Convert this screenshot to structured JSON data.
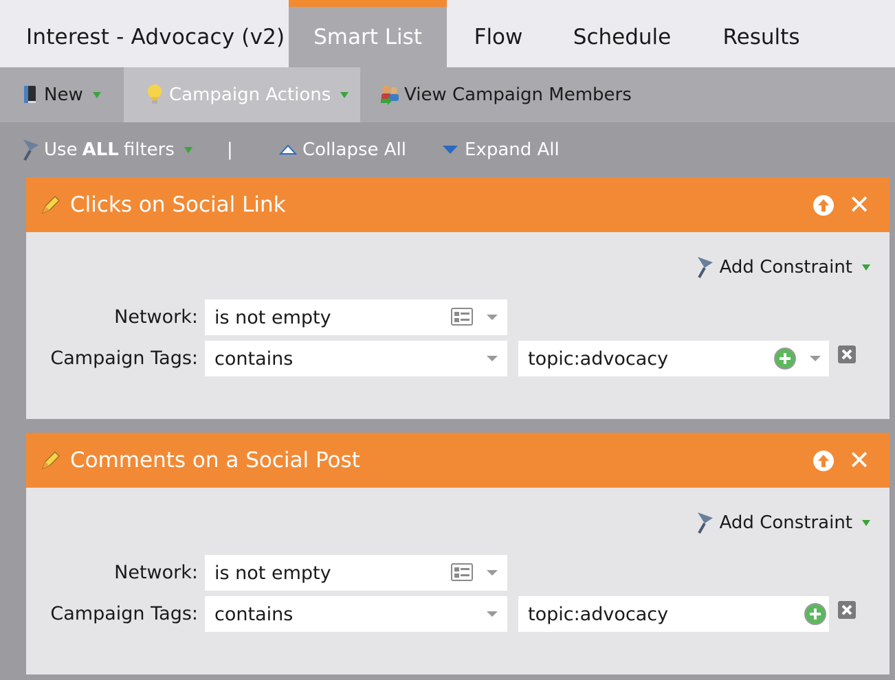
{
  "app": {
    "title": "Interest - Advocacy (v2)",
    "tabs": [
      {
        "label": "Smart List",
        "active": true
      },
      {
        "label": "Flow",
        "active": false
      },
      {
        "label": "Schedule",
        "active": false
      },
      {
        "label": "Results",
        "active": false
      }
    ]
  },
  "toolbar": {
    "new_label": "New",
    "campaign_actions_label": "Campaign Actions",
    "view_members_label": "View Campaign Members"
  },
  "filterbar": {
    "use_prefix": "Use",
    "use_bold": "ALL",
    "use_suffix": "filters",
    "separator": "|",
    "collapse_label": "Collapse All",
    "expand_label": "Expand All"
  },
  "filters": [
    {
      "title": "Clicks on Social Link",
      "add_constraint_label": "Add Constraint",
      "network_label": "Network:",
      "network_operator": "is not empty",
      "tags_label": "Campaign Tags:",
      "tags_operator": "contains",
      "tags_value": "topic:advocacy"
    },
    {
      "title": "Comments on a Social Post",
      "add_constraint_label": "Add Constraint",
      "network_label": "Network:",
      "network_operator": "is not empty",
      "tags_label": "Campaign Tags:",
      "tags_operator": "contains",
      "tags_value": "topic:advocacy"
    }
  ],
  "colors": {
    "accent_orange": "#f28a35",
    "caret_green": "#3aa43a",
    "background_gray": "#9b9ba0"
  }
}
